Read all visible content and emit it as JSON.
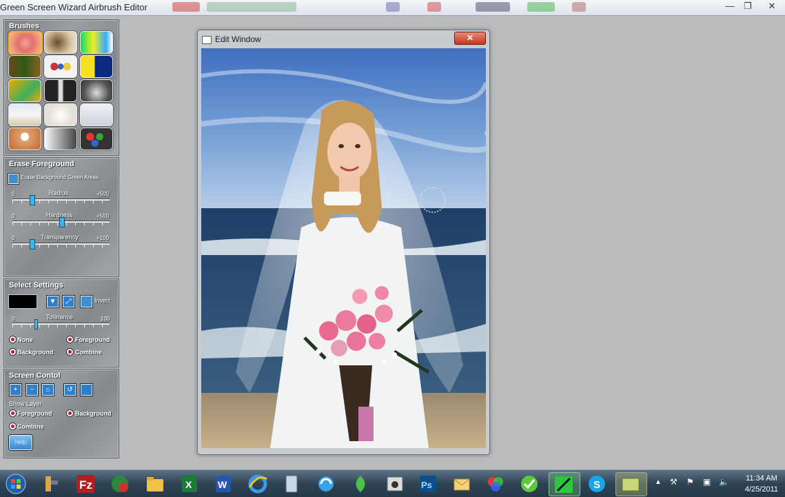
{
  "app": {
    "title": "Green Screen Wizard Airbrush Editor"
  },
  "window_controls": {
    "minimize": "—",
    "maximize": "❐",
    "close": "✕"
  },
  "brushes": {
    "title": "Brushes"
  },
  "erase": {
    "title": "Erase Foreground",
    "checkbox_label": "Erase Background Green Areas",
    "radius": {
      "label": "Radius",
      "min": "0",
      "max": "+500",
      "value_fraction": 0.2
    },
    "hardness": {
      "label": "Hardness",
      "min": "0",
      "max": "+500",
      "value_fraction": 0.5
    },
    "transparency": {
      "label": "Transparency",
      "min": "0",
      "max": "+100",
      "value_fraction": 0.2
    }
  },
  "select": {
    "title": "Select Settings",
    "invert_label": "Invert",
    "tolerance": {
      "label": "Tolerance",
      "min": "0",
      "max": "100",
      "value_fraction": 0.25
    },
    "radios": {
      "none": "None",
      "foreground": "Foreground",
      "background": "Background",
      "combine": "Combine"
    }
  },
  "screen": {
    "title": "Screen Contol",
    "show_layer": "Show Layer",
    "radios": {
      "foreground": "Foreground",
      "background": "Background",
      "combine": "Combine"
    },
    "help_button": "Help"
  },
  "edit_window": {
    "title": "Edit Window",
    "close": "✕"
  },
  "taskbar": {
    "time": "11:34 AM",
    "date": "4/25/2011"
  },
  "colors": {
    "accent_blue": "#2f7fd0",
    "slider_thumb": "#38b7e8",
    "radio_dot": "#c0142a",
    "close_red": "#c6361f"
  }
}
